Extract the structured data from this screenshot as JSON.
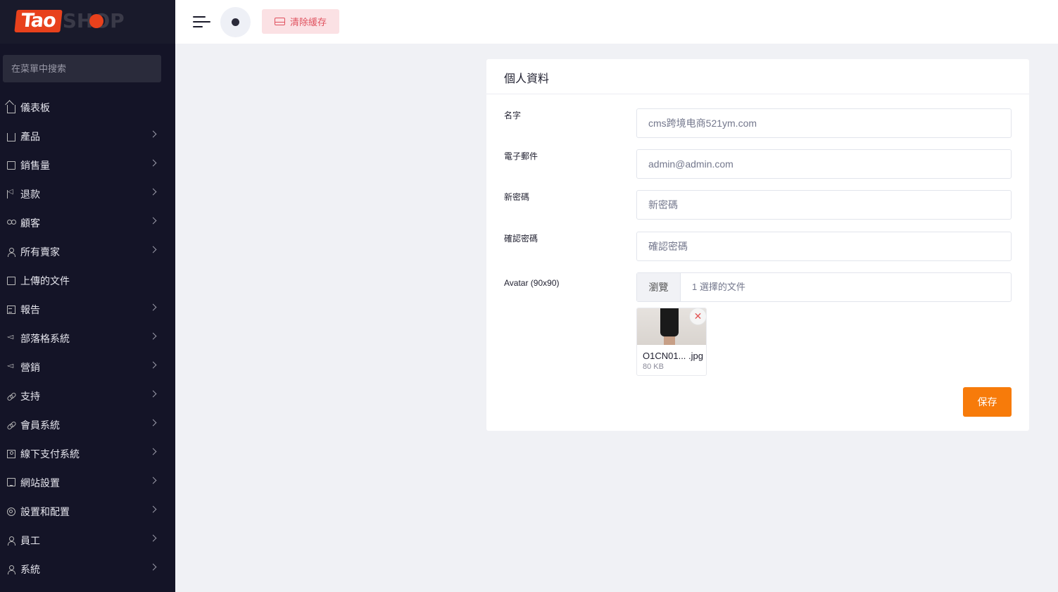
{
  "sidebar": {
    "logo": {
      "part1": "Tao",
      "part2": "SHOP"
    },
    "search_placeholder": "在菜單中搜索",
    "items": [
      {
        "label": "儀表板",
        "icon": "home-icon",
        "chevron": false
      },
      {
        "label": "產品",
        "icon": "cart-icon",
        "chevron": true
      },
      {
        "label": "銷售量",
        "icon": "bill-icon",
        "chevron": true
      },
      {
        "label": "退款",
        "icon": "refund-icon",
        "chevron": true
      },
      {
        "label": "顧客",
        "icon": "users-icon",
        "chevron": true
      },
      {
        "label": "所有賣家",
        "icon": "user-icon",
        "chevron": true
      },
      {
        "label": "上傳的文件",
        "icon": "file-icon",
        "chevron": false
      },
      {
        "label": "報告",
        "icon": "report-icon",
        "chevron": true
      },
      {
        "label": "部落格系統",
        "icon": "megaphone-icon",
        "chevron": true
      },
      {
        "label": "營銷",
        "icon": "megaphone-icon",
        "chevron": true
      },
      {
        "label": "支持",
        "icon": "link-icon",
        "chevron": true
      },
      {
        "label": "會員系統",
        "icon": "link-icon",
        "chevron": true
      },
      {
        "label": "線下支付系統",
        "icon": "money-icon",
        "chevron": true
      },
      {
        "label": "網站設置",
        "icon": "monitor-icon",
        "chevron": true
      },
      {
        "label": "設置和配置",
        "icon": "gear-icon",
        "chevron": true
      },
      {
        "label": "員工",
        "icon": "user-icon",
        "chevron": true
      },
      {
        "label": "系統",
        "icon": "user-icon",
        "chevron": true
      }
    ]
  },
  "topbar": {
    "clear_cache_label": "清除緩存"
  },
  "profile": {
    "title": "個人資料",
    "name_label": "名字",
    "name_value": "cms跨境电商521ym.com",
    "email_label": "電子郵件",
    "email_value": "admin@admin.com",
    "new_password_label": "新密碼",
    "new_password_placeholder": "新密碼",
    "confirm_password_label": "確認密碼",
    "confirm_password_placeholder": "確認密碼",
    "avatar_label": "Avatar (90x90)",
    "browse_label": "瀏覽",
    "file_selected_text": "1 選擇的文件",
    "file_name": "O1CN01... .jpg",
    "file_size": "80 KB",
    "remove_glyph": "✕",
    "save_label": "保存"
  },
  "colors": {
    "sidebar_bg": "#141427",
    "accent_orange": "#f77b0a",
    "cache_btn_bg": "#fbe1e4",
    "cache_btn_text": "#e0525f"
  }
}
